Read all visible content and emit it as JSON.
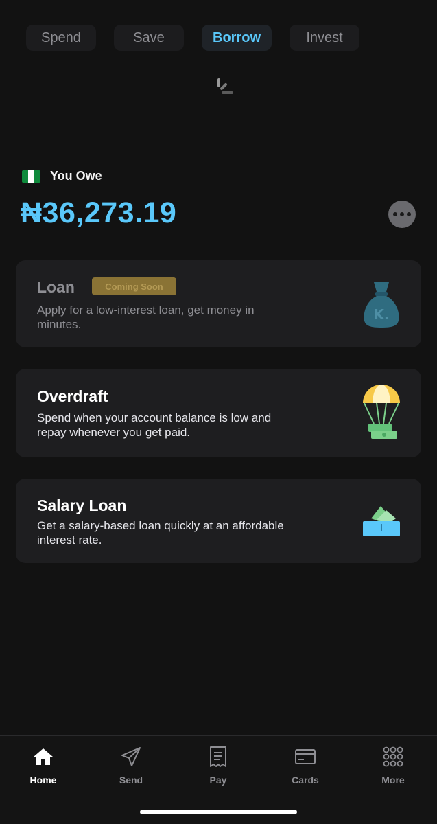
{
  "tabs": [
    {
      "label": "Spend",
      "active": false
    },
    {
      "label": "Save",
      "active": false
    },
    {
      "label": "Borrow",
      "active": true
    },
    {
      "label": "Invest",
      "active": false
    }
  ],
  "balance": {
    "label": "You Owe",
    "amount": "₦36,273.19",
    "flag": "nigeria-flag-icon"
  },
  "cards": {
    "loan": {
      "title": "Loan",
      "badge": "Coming Soon",
      "description": "Apply for a low-interest loan, get money in minutes.",
      "icon": "money-bag-icon"
    },
    "overdraft": {
      "title": "Overdraft",
      "description": "Spend when your account balance is low and repay whenever you get paid.",
      "icon": "parachute-money-icon"
    },
    "salary_loan": {
      "title": "Salary Loan",
      "description": "Get a salary-based loan quickly at an affordable interest rate.",
      "icon": "cash-pocket-icon"
    }
  },
  "nav": {
    "home": "Home",
    "send": "Send",
    "pay": "Pay",
    "cards": "Cards",
    "more": "More"
  },
  "colors": {
    "accent": "#5ac8fa",
    "background": "#121212",
    "card": "#1e1e20",
    "badge": "#8a7335"
  }
}
